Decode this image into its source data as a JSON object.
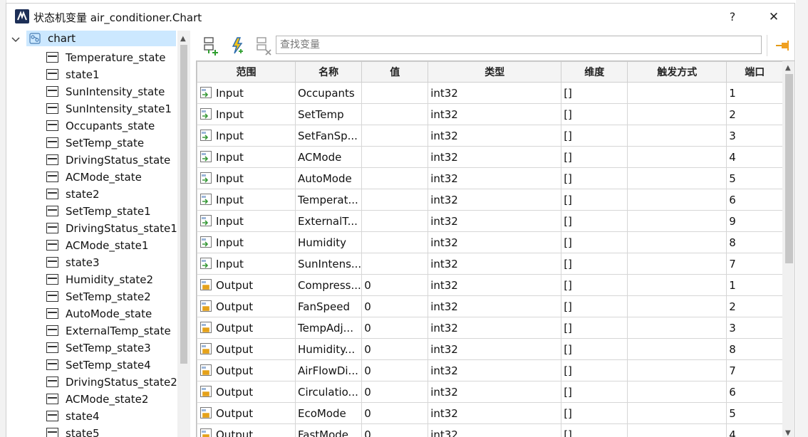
{
  "window": {
    "title": "状态机变量 air_conditioner.Chart",
    "help_label": "?",
    "close_label": "✕"
  },
  "tree": {
    "root_label": "chart",
    "items": [
      {
        "label": "Temperature_state"
      },
      {
        "label": "state1"
      },
      {
        "label": "SunIntensity_state"
      },
      {
        "label": "SunIntensity_state1"
      },
      {
        "label": "Occupants_state"
      },
      {
        "label": "SetTemp_state"
      },
      {
        "label": "DrivingStatus_state"
      },
      {
        "label": "ACMode_state"
      },
      {
        "label": "state2"
      },
      {
        "label": "SetTemp_state1"
      },
      {
        "label": "DrivingStatus_state1"
      },
      {
        "label": "ACMode_state1"
      },
      {
        "label": "state3"
      },
      {
        "label": "Humidity_state2"
      },
      {
        "label": "SetTemp_state2"
      },
      {
        "label": "AutoMode_state"
      },
      {
        "label": "ExternalTemp_state"
      },
      {
        "label": "SetTemp_state3"
      },
      {
        "label": "SetTemp_state4"
      },
      {
        "label": "DrivingStatus_state2"
      },
      {
        "label": "ACMode_state2"
      },
      {
        "label": "state4"
      },
      {
        "label": "state5"
      }
    ]
  },
  "toolbar": {
    "search_placeholder": "查找变量",
    "icons": [
      "add-variable-icon",
      "flash-event-icon",
      "delete-variable-icon",
      "pin-icon"
    ]
  },
  "table": {
    "columns": [
      "范围",
      "名称",
      "值",
      "类型",
      "维度",
      "触发方式",
      "端口"
    ],
    "rows": [
      {
        "scope": "Input",
        "name": "Occupants",
        "value": "",
        "type": "int32",
        "dim": "[]",
        "trigger": "",
        "port": "1"
      },
      {
        "scope": "Input",
        "name": "SetTemp",
        "value": "",
        "type": "int32",
        "dim": "[]",
        "trigger": "",
        "port": "2"
      },
      {
        "scope": "Input",
        "name": "SetFanSp...",
        "value": "",
        "type": "int32",
        "dim": "[]",
        "trigger": "",
        "port": "3"
      },
      {
        "scope": "Input",
        "name": "ACMode",
        "value": "",
        "type": "int32",
        "dim": "[]",
        "trigger": "",
        "port": "4"
      },
      {
        "scope": "Input",
        "name": "AutoMode",
        "value": "",
        "type": "int32",
        "dim": "[]",
        "trigger": "",
        "port": "5"
      },
      {
        "scope": "Input",
        "name": "Temperat...",
        "value": "",
        "type": "int32",
        "dim": "[]",
        "trigger": "",
        "port": "6"
      },
      {
        "scope": "Input",
        "name": "ExternalT...",
        "value": "",
        "type": "int32",
        "dim": "[]",
        "trigger": "",
        "port": "9"
      },
      {
        "scope": "Input",
        "name": "Humidity",
        "value": "",
        "type": "int32",
        "dim": "[]",
        "trigger": "",
        "port": "8"
      },
      {
        "scope": "Input",
        "name": "SunIntens...",
        "value": "",
        "type": "int32",
        "dim": "[]",
        "trigger": "",
        "port": "7"
      },
      {
        "scope": "Output",
        "name": "Compress...",
        "value": "0",
        "type": "int32",
        "dim": "[]",
        "trigger": "",
        "port": "1"
      },
      {
        "scope": "Output",
        "name": "FanSpeed",
        "value": "0",
        "type": "int32",
        "dim": "[]",
        "trigger": "",
        "port": "2"
      },
      {
        "scope": "Output",
        "name": "TempAdj...",
        "value": "0",
        "type": "int32",
        "dim": "[]",
        "trigger": "",
        "port": "3"
      },
      {
        "scope": "Output",
        "name": "Humidity...",
        "value": "0",
        "type": "int32",
        "dim": "[]",
        "trigger": "",
        "port": "8"
      },
      {
        "scope": "Output",
        "name": "AirFlowDi...",
        "value": "0",
        "type": "int32",
        "dim": "[]",
        "trigger": "",
        "port": "7"
      },
      {
        "scope": "Output",
        "name": "Circulatio...",
        "value": "0",
        "type": "int32",
        "dim": "[]",
        "trigger": "",
        "port": "6"
      },
      {
        "scope": "Output",
        "name": "EcoMode",
        "value": "0",
        "type": "int32",
        "dim": "[]",
        "trigger": "",
        "port": "5"
      },
      {
        "scope": "Output",
        "name": "FastMode",
        "value": "0",
        "type": "int32",
        "dim": "[]",
        "trigger": "",
        "port": "4"
      }
    ]
  },
  "colors": {
    "selection": "#cce8ff",
    "input_icon": "#3a9a3a",
    "output_icon": "#e5a21a",
    "accent_orange": "#f0a020"
  }
}
